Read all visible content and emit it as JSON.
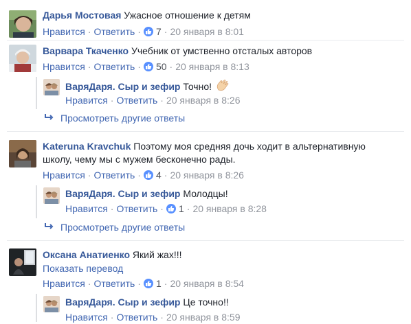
{
  "actions": {
    "like": "Нравится",
    "reply": "Ответить",
    "dot": "·"
  },
  "comments": [
    {
      "author": "Дарья Мостовая",
      "text": "Ужасное отношение к детям",
      "likes": "7",
      "time": "20 января в 8:01"
    },
    {
      "author": "Варвара Ткаченко",
      "text": "Учебник от умственно отсталых авторов",
      "likes": "50",
      "time": "20 января в 8:13",
      "reply": {
        "author": "ВаряДаря. Сыр и зефир",
        "text": "Точно!",
        "time": "20 января в 8:26",
        "emoji": "clapping-hands-icon"
      },
      "more_replies": "Просмотреть другие ответы"
    },
    {
      "author": "Kateruna Kravchuk",
      "text_line1": "Поэтому моя средняя дочь ходит в альтернативную",
      "text_line2": "школу, чему мы с мужем бесконечно рады.",
      "likes": "4",
      "time": "20 января в 8:26",
      "reply": {
        "author": "ВаряДаря. Сыр и зефир",
        "text": "Молодцы!",
        "likes": "1",
        "time": "20 января в 8:28"
      },
      "more_replies": "Просмотреть другие ответы"
    },
    {
      "author": "Оксана Анатиенко",
      "text": "Який жах!!!",
      "translate": "Показать перевод",
      "likes": "1",
      "time": "20 января в 8:54",
      "reply": {
        "author": "ВаряДаря. Сыр и зефир",
        "text": "Це точно!!",
        "time": "20 января в 8:59"
      }
    }
  ],
  "colors": {
    "link": "#4267b2",
    "author": "#365899",
    "like_badge": "#5890ff",
    "meta": "#90949c"
  }
}
